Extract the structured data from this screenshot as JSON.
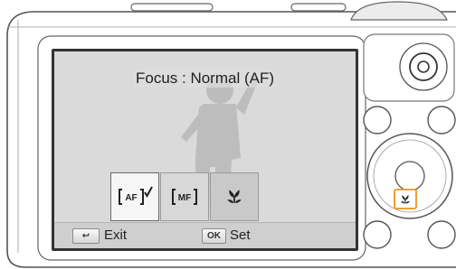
{
  "screen": {
    "title": "Focus : Normal (AF)",
    "options": [
      {
        "label": "AF",
        "icon": "af-normal-icon",
        "selected": true
      },
      {
        "label": "MF",
        "icon": "manual-focus-icon",
        "selected": false
      },
      {
        "label": "",
        "icon": "macro-flower-icon",
        "selected": false
      }
    ],
    "footer": {
      "back_key": "↩",
      "back_label": "Exit",
      "ok_key": "OK",
      "ok_label": "Set"
    }
  },
  "camera": {
    "highlighted_button": "macro-flower-icon",
    "highlight_color": "#f0a030"
  }
}
